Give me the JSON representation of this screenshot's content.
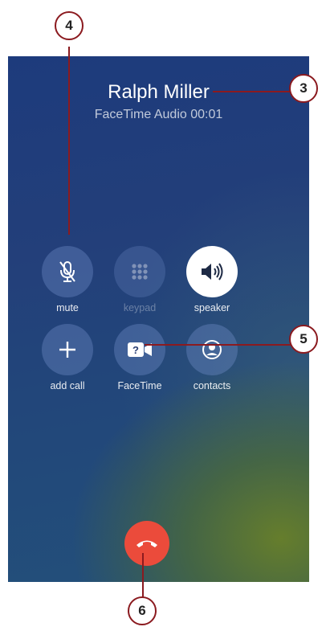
{
  "call": {
    "caller_name": "Ralph Miller",
    "status": "FaceTime Audio 00:01"
  },
  "buttons": {
    "mute": {
      "label": "mute",
      "icon": "mic-slash-icon"
    },
    "keypad": {
      "label": "keypad",
      "icon": "keypad-icon"
    },
    "speaker": {
      "label": "speaker",
      "icon": "speaker-icon"
    },
    "add_call": {
      "label": "add call",
      "icon": "plus-icon"
    },
    "facetime": {
      "label": "FaceTime",
      "icon": "video-camera-icon"
    },
    "contacts": {
      "label": "contacts",
      "icon": "contact-icon"
    },
    "end_call": {
      "icon": "phone-hangup-icon"
    }
  },
  "callouts": [
    "4",
    "3",
    "5",
    "6"
  ],
  "colors": {
    "end_call": "#eb4b3b",
    "callout_border": "#8b1a1f"
  }
}
